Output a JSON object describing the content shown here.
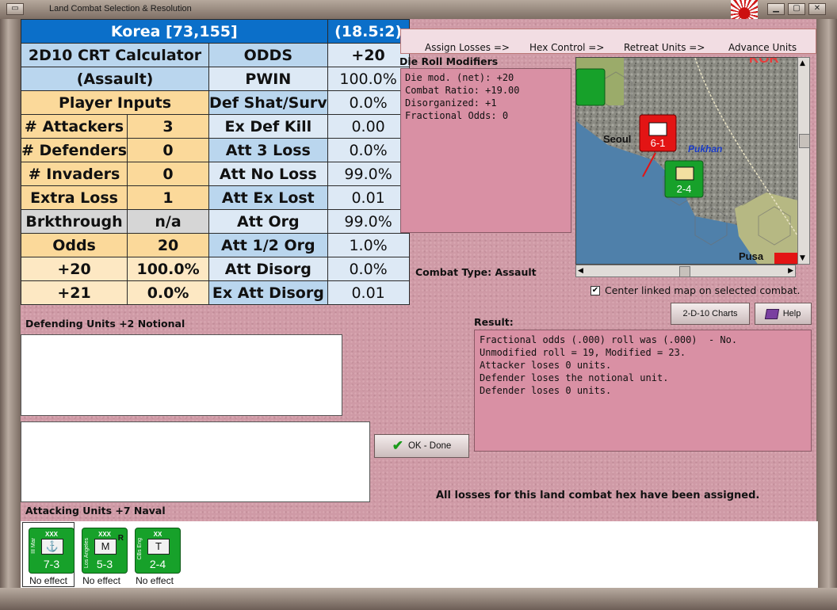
{
  "window": {
    "title": "Land Combat Selection & Resolution"
  },
  "crt": {
    "location": "Korea [73,155]",
    "ratio": "(18.5:2)",
    "calc_title": "2D10 CRT Calculator",
    "calc_mode": "(Assault)",
    "player_inputs": "Player Inputs",
    "inputs": [
      {
        "label": "# Attackers",
        "value": "3"
      },
      {
        "label": "# Defenders",
        "value": "0"
      },
      {
        "label": "# Invaders",
        "value": "0"
      },
      {
        "label": "Extra Loss",
        "value": "1"
      },
      {
        "label": "Brkthrough",
        "value": "n/a"
      },
      {
        "label": "Odds",
        "value": "20"
      },
      {
        "label": "+20",
        "value": "100.0%"
      },
      {
        "label": "+21",
        "value": "0.0%"
      }
    ],
    "results": [
      {
        "label": "ODDS",
        "value": "+20"
      },
      {
        "label": "PWIN",
        "value": "100.0%"
      },
      {
        "label": "Def Shat/Surv",
        "value": "0.0%"
      },
      {
        "label": "Ex Def Kill",
        "value": "0.00"
      },
      {
        "label": "Att 3 Loss",
        "value": "0.0%"
      },
      {
        "label": "Att No Loss",
        "value": "99.0%"
      },
      {
        "label": "Att Ex Lost",
        "value": "0.01"
      },
      {
        "label": "Att Org",
        "value": "99.0%"
      },
      {
        "label": "Att 1/2 Org",
        "value": "1.0%"
      },
      {
        "label": "Att Disorg",
        "value": "0.0%"
      },
      {
        "label": "Ex Att Disorg",
        "value": "0.01"
      }
    ]
  },
  "steps": [
    "Assign Losses =>",
    "Hex Control =>",
    "Retreat Units =>",
    "Advance Units"
  ],
  "modifiers": {
    "title": "Die Roll Modifiers",
    "lines": [
      "Die mod. (net): +20",
      "",
      "Combat Ratio: +19.00",
      "Disorganized: +1",
      "Fractional Odds: 0"
    ]
  },
  "combat_type": {
    "label": "Combat Type:",
    "value": "Assault"
  },
  "map": {
    "labels": [
      "Seoul",
      "Pukhan",
      "Pusa",
      "KOR"
    ],
    "units": [
      "6-1",
      "2-4"
    ],
    "center_link": "Center linked map on selected combat."
  },
  "buttons": {
    "charts": "2-D-10 Charts",
    "help": "Help",
    "ok": "OK - Done"
  },
  "result": {
    "title": "Result:",
    "lines": [
      "Fractional odds (.000) roll was (.000)  - No.",
      "Unmodified roll = 19, Modified = 23.",
      "Attacker loses 0 units.",
      "Defender loses the notional unit.",
      "Defender loses 0 units."
    ]
  },
  "defending": {
    "title": "Defending Units +2 Notional"
  },
  "status": "All losses for this land combat hex have been assigned.",
  "attacking": {
    "title": "Attacking Units +7 Naval",
    "units": [
      {
        "size": "XXX",
        "name": "III Mar",
        "symbol": "⚓",
        "value": "7-3",
        "effect": "No effect"
      },
      {
        "size": "XXX",
        "name": "Los Angeles",
        "symbol": "M",
        "value": "5-3",
        "effect": "No effect"
      },
      {
        "size": "XX",
        "name": "CBs Eng",
        "symbol": "T",
        "value": "2-4",
        "effect": "No effect"
      }
    ]
  }
}
